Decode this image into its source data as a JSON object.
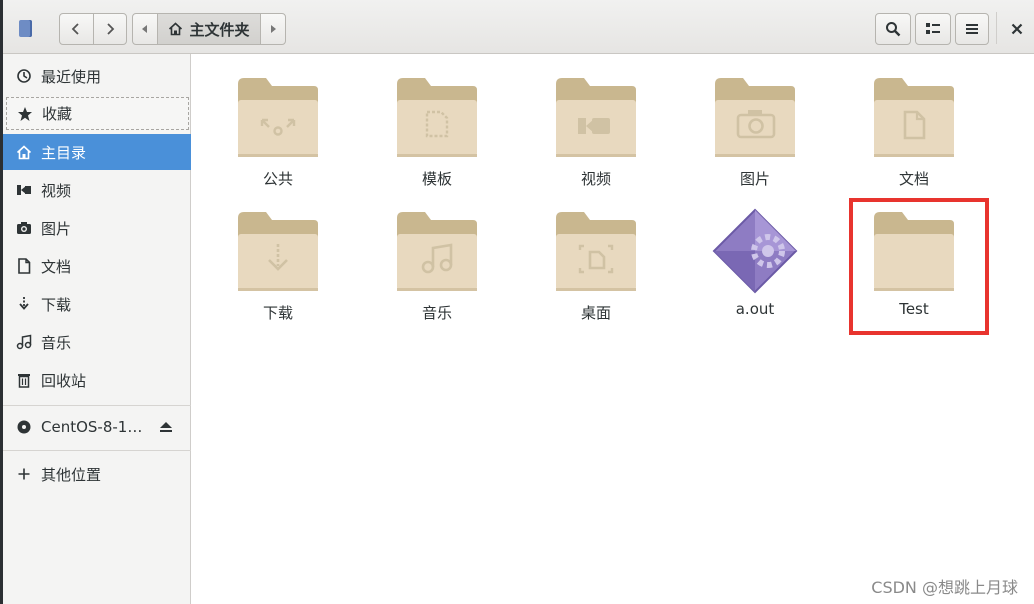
{
  "header": {
    "location_label": "主文件夹"
  },
  "sidebar": {
    "items": [
      {
        "label": "最近使用",
        "icon": "clock-icon"
      },
      {
        "label": "收藏",
        "icon": "star-icon"
      },
      {
        "label": "主目录",
        "icon": "home-icon"
      },
      {
        "label": "视频",
        "icon": "video-icon"
      },
      {
        "label": "图片",
        "icon": "camera-icon"
      },
      {
        "label": "文档",
        "icon": "document-icon"
      },
      {
        "label": "下载",
        "icon": "download-icon"
      },
      {
        "label": "音乐",
        "icon": "music-icon"
      },
      {
        "label": "回收站",
        "icon": "trash-icon"
      }
    ],
    "device": {
      "label": "CentOS-8-1…",
      "icon": "disc-icon"
    },
    "other": {
      "label": "其他位置",
      "icon": "plus-icon"
    }
  },
  "files": [
    {
      "name": "公共",
      "type": "folder",
      "emblem": "share"
    },
    {
      "name": "模板",
      "type": "folder",
      "emblem": "template"
    },
    {
      "name": "视频",
      "type": "folder",
      "emblem": "video"
    },
    {
      "name": "图片",
      "type": "folder",
      "emblem": "camera"
    },
    {
      "name": "文档",
      "type": "folder",
      "emblem": "document"
    },
    {
      "name": "下载",
      "type": "folder",
      "emblem": "download"
    },
    {
      "name": "音乐",
      "type": "folder",
      "emblem": "music"
    },
    {
      "name": "桌面",
      "type": "folder",
      "emblem": "desktop"
    },
    {
      "name": "a.out",
      "type": "executable",
      "emblem": "executable"
    },
    {
      "name": "Test",
      "type": "folder",
      "emblem": "none"
    }
  ],
  "watermark": "CSDN @想跳上月球",
  "colors": {
    "accent": "#4a90d9",
    "folder": "#e8d9bf",
    "folder_tab": "#c9b78f",
    "highlight": "#e8342e"
  }
}
